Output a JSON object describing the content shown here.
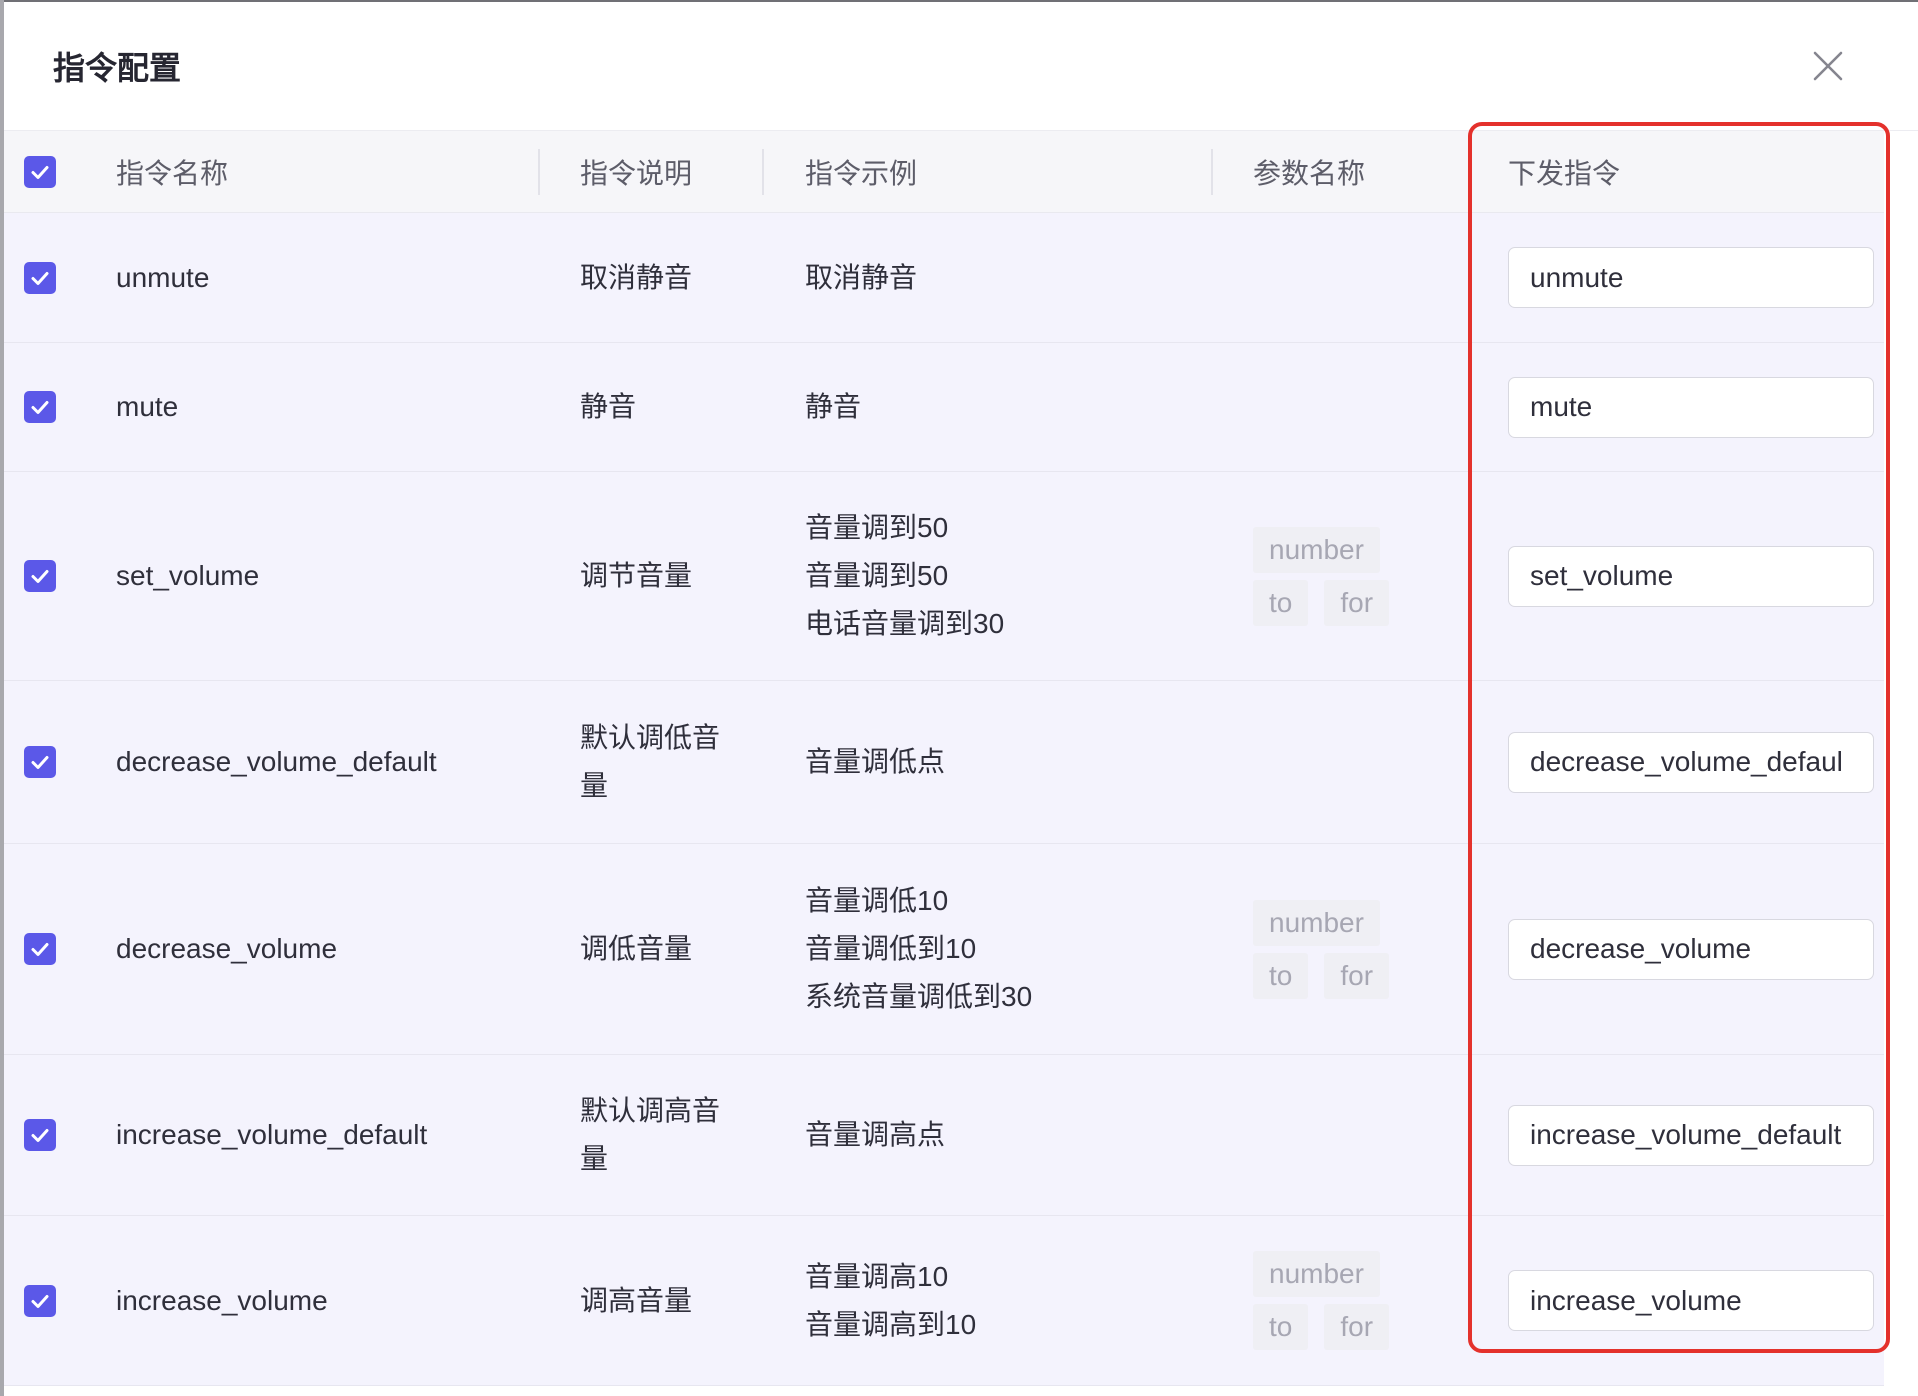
{
  "dialog": {
    "title": "指令配置"
  },
  "icons": {
    "close": "close-icon",
    "check": "check-icon"
  },
  "colors": {
    "accent": "#5b58e8",
    "highlight_border": "#e4312c"
  },
  "table": {
    "all_selected": true,
    "columns": {
      "name": "指令名称",
      "description": "指令说明",
      "example": "指令示例",
      "params": "参数名称",
      "command": "下发指令"
    },
    "rows": [
      {
        "selected": true,
        "name": "unmute",
        "description": "取消静音",
        "examples": [
          "取消静音"
        ],
        "params": [],
        "command": "unmute"
      },
      {
        "selected": true,
        "name": "mute",
        "description": "静音",
        "examples": [
          "静音"
        ],
        "params": [],
        "command": "mute"
      },
      {
        "selected": true,
        "name": "set_volume",
        "description": "调节音量",
        "examples": [
          "音量调到50",
          "音量调到50",
          "电话音量调到30"
        ],
        "params": [
          "number",
          "to",
          "for"
        ],
        "command": "set_volume"
      },
      {
        "selected": true,
        "name": "decrease_volume_default",
        "description": "默认调低音量",
        "examples": [
          "音量调低点"
        ],
        "params": [],
        "command": "decrease_volume_defaul"
      },
      {
        "selected": true,
        "name": "decrease_volume",
        "description": "调低音量",
        "examples": [
          "音量调低10",
          "音量调低到10",
          "系统音量调低到30"
        ],
        "params": [
          "number",
          "to",
          "for"
        ],
        "command": "decrease_volume"
      },
      {
        "selected": true,
        "name": "increase_volume_default",
        "description": "默认调高音量",
        "examples": [
          "音量调高点"
        ],
        "params": [],
        "command": "increase_volume_default"
      },
      {
        "selected": true,
        "name": "increase_volume",
        "description": "调高音量",
        "examples": [
          "音量调高10",
          "音量调高到10"
        ],
        "params": [
          "number",
          "to",
          "for"
        ],
        "command": "increase_volume"
      }
    ]
  }
}
